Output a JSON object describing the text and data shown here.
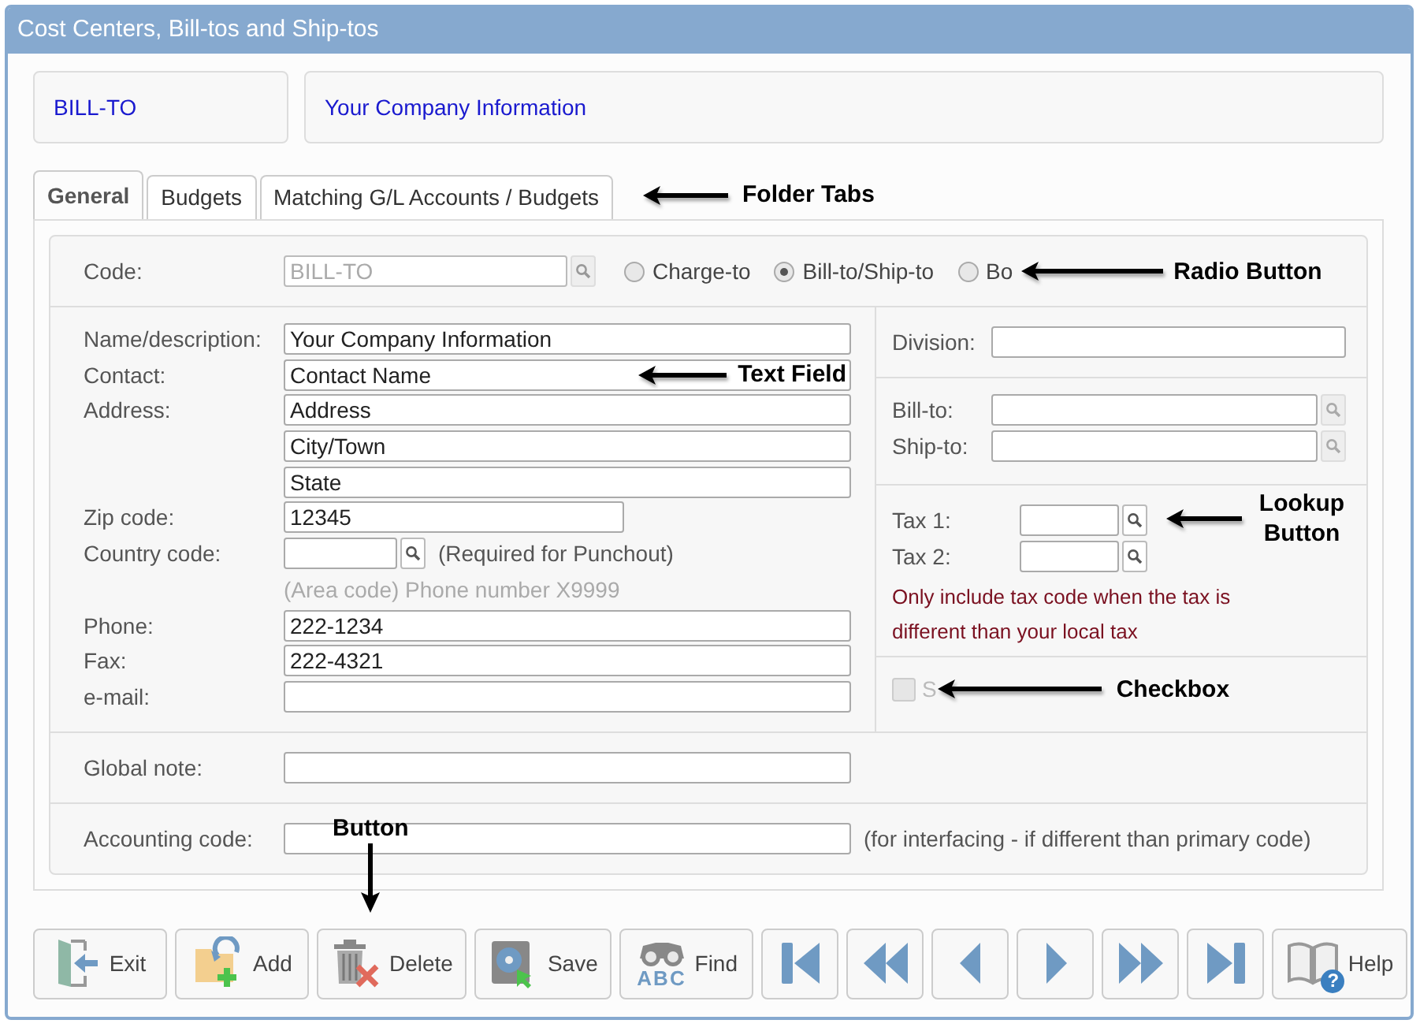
{
  "window": {
    "title": "Cost Centers, Bill-tos and Ship-tos"
  },
  "header": {
    "code": "BILL-TO",
    "name": "Your Company Information"
  },
  "tabs": [
    {
      "label": "General",
      "selected": true
    },
    {
      "label": "Budgets",
      "selected": false
    },
    {
      "label": "Matching G/L Accounts / Budgets",
      "selected": false
    }
  ],
  "tabs_callout": "Folder Tabs",
  "code_row": {
    "label": "Code:",
    "value": "BILL-TO",
    "disabled": true,
    "callout": "Radio Button",
    "radios": [
      {
        "label": "Charge-to",
        "selected": false
      },
      {
        "label": "Bill-to/Ship-to",
        "selected": true
      },
      {
        "label": "Bo",
        "selected": false
      }
    ]
  },
  "address_fields": [
    {
      "kind": "text",
      "label": "Name/description:",
      "value": "Your Company Information"
    },
    {
      "kind": "text",
      "label": "Contact:",
      "value": "Contact Name",
      "callout": "Text Field"
    },
    {
      "kind": "text",
      "label": "Address:",
      "value": "Address"
    },
    {
      "kind": "text",
      "value": "City/Town"
    },
    {
      "kind": "text",
      "value": "State"
    },
    {
      "kind": "short",
      "label": "Zip code:",
      "value": "12345"
    },
    {
      "kind": "lookup",
      "label": "Country code:",
      "note": "(Required for Punchout)"
    },
    {
      "kind": "hint",
      "text": "(Area code) Phone number X9999"
    },
    {
      "kind": "text",
      "label": "Phone:",
      "value": "222-1234"
    },
    {
      "kind": "text",
      "label": "Fax:",
      "value": "222-4321"
    },
    {
      "kind": "text",
      "label": "e-mail:"
    }
  ],
  "division": {
    "label": "Division:"
  },
  "parties": [
    {
      "label": "Bill-to:"
    },
    {
      "label": "Ship-to:"
    }
  ],
  "taxes": {
    "fields": [
      {
        "label": "Tax 1:"
      },
      {
        "label": "Tax 2:"
      }
    ],
    "callout": "Lookup Button",
    "note": "Only include tax code when the tax is different than your local tax"
  },
  "stock": {
    "label": "S",
    "checked": false,
    "disabled": true,
    "callout": "Checkbox"
  },
  "global_note": {
    "label": "Global note:"
  },
  "accounting": {
    "label": "Accounting code:",
    "note": "(for interfacing - if different than primary code)"
  },
  "toolbar": [
    {
      "kind": "exit",
      "label": "Exit"
    },
    {
      "kind": "add",
      "label": "Add"
    },
    {
      "kind": "delete",
      "label": "Delete",
      "callout": "Button"
    },
    {
      "kind": "save",
      "label": "Save"
    },
    {
      "kind": "find",
      "label": "Find",
      "badge": "ABC"
    },
    {
      "kind": "first"
    },
    {
      "kind": "rewind"
    },
    {
      "kind": "prev"
    },
    {
      "kind": "next"
    },
    {
      "kind": "forward"
    },
    {
      "kind": "last"
    },
    {
      "kind": "help",
      "label": "Help",
      "badge": "?"
    }
  ]
}
